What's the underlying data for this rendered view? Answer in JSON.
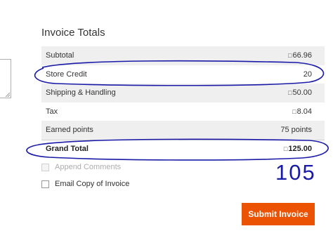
{
  "section": {
    "title": "Invoice Totals"
  },
  "totals": {
    "rows": [
      {
        "label": "Subtotal",
        "currency_glyph": "□",
        "value": "66.96"
      },
      {
        "label": "Store Credit",
        "currency_glyph": "",
        "value": "20"
      },
      {
        "label": "Shipping & Handling",
        "currency_glyph": "□",
        "value": "50.00"
      },
      {
        "label": "Tax",
        "currency_glyph": "□",
        "value": "8.04"
      },
      {
        "label": "Earned points",
        "currency_glyph": "",
        "value": "75 points"
      }
    ],
    "grand": {
      "label": "Grand Total",
      "currency_glyph": "□",
      "value": "125.00"
    }
  },
  "options": {
    "append_comments": "Append Comments",
    "email_copy": "Email Copy of Invoice"
  },
  "actions": {
    "submit": "Submit Invoice"
  },
  "handwritten_note": "105",
  "colors": {
    "accent": "#eb5202",
    "annotation_ink": "#1a1aa8"
  }
}
